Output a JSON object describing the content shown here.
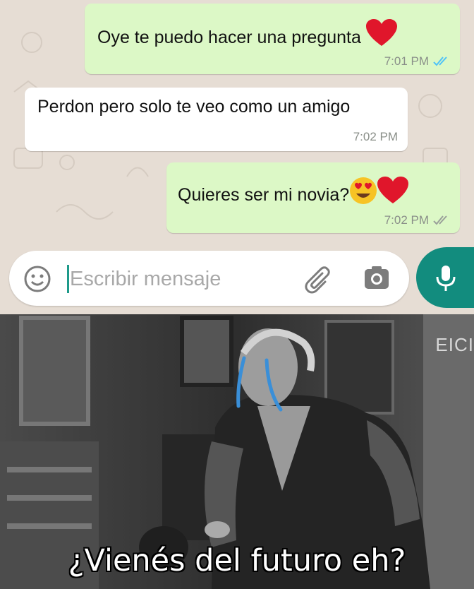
{
  "messages": [
    {
      "direction": "outgoing",
      "text": "Oye te puedo hacer una pregunta",
      "emoji": [
        "heart"
      ],
      "time": "7:01 PM",
      "status": "read"
    },
    {
      "direction": "incoming",
      "text": "Perdon pero solo te veo como un amigo",
      "time": "7:02 PM"
    },
    {
      "direction": "outgoing",
      "text": "Quieres ser mi novia?",
      "emoji": [
        "heart-eyes",
        "heart"
      ],
      "time": "7:02 PM",
      "status": "delivered"
    }
  ],
  "input": {
    "placeholder": "Escribir mensaje",
    "value": ""
  },
  "icons": {
    "emoji": "smiley-icon",
    "attach": "paperclip-icon",
    "camera": "camera-icon",
    "mic": "microphone-icon"
  },
  "colors": {
    "outgoing_bubble": "#dcf8c6",
    "incoming_bubble": "#ffffff",
    "chat_background": "#e6ddd4",
    "accent": "#128c7e",
    "read_tick": "#4fc3f7",
    "tear": "#3a8fd8"
  },
  "meme": {
    "caption": "¿Vienés del futuro eh?",
    "watermark": "EICI"
  }
}
